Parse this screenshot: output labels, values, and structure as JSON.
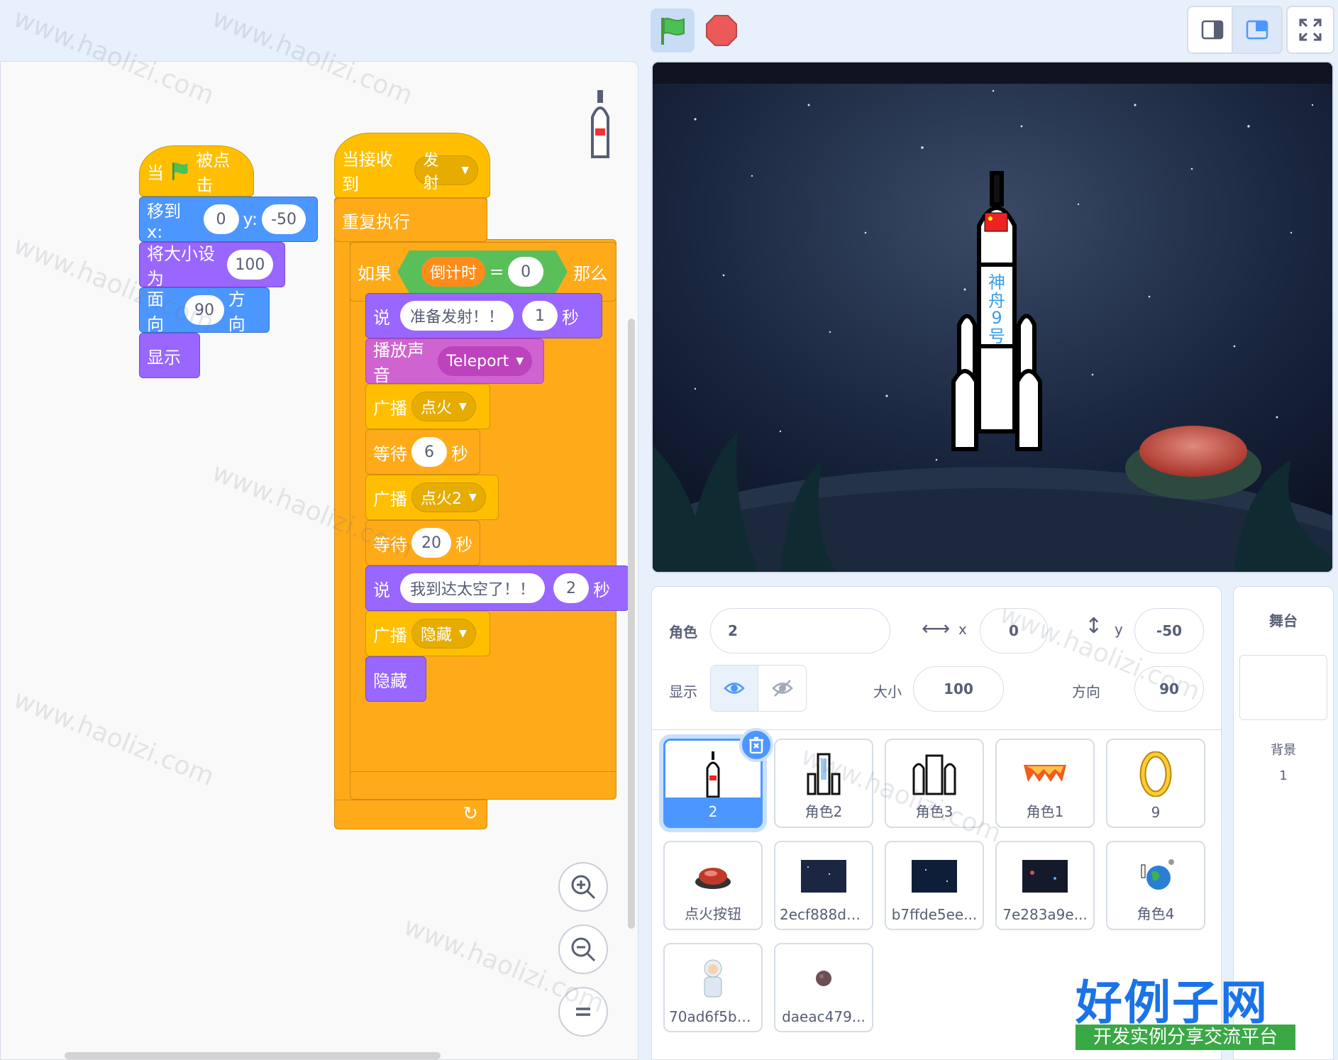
{
  "toolbar": {
    "green_flag": "green-flag-icon",
    "stop": "stop-icon"
  },
  "scripts": {
    "script1": {
      "hat_when": "当",
      "hat_clicked": "被点击",
      "goto_label": "移到 x:",
      "goto_x": "0",
      "goto_y_label": "y:",
      "goto_y": "-50",
      "setsize_label": "将大小设为",
      "setsize_value": "100",
      "point_label": "面向",
      "point_value": "90",
      "point_suffix": "方向",
      "show_label": "显示"
    },
    "script2": {
      "hat_label": "当接收到",
      "hat_message": "发射",
      "forever_label": "重复执行",
      "if_label": "如果",
      "if_var": "倒计时",
      "if_op": "=",
      "if_value": "0",
      "if_then": "那么",
      "say1_label": "说",
      "say1_text": "准备发射！！",
      "say1_secs": "1",
      "say1_unit": "秒",
      "sound_label": "播放声音",
      "sound_name": "Teleport",
      "bc1_label": "广播",
      "bc1_msg": "点火",
      "wait1_label": "等待",
      "wait1_value": "6",
      "wait1_unit": "秒",
      "bc2_label": "广播",
      "bc2_msg": "点火2",
      "wait2_label": "等待",
      "wait2_value": "20",
      "wait2_unit": "秒",
      "say2_label": "说",
      "say2_text": "我到达太空了！！",
      "say2_secs": "2",
      "say2_unit": "秒",
      "bc3_label": "广播",
      "bc3_msg": "隐藏",
      "hide_label": "隐藏"
    }
  },
  "stage": {
    "rocket_text": [
      "神",
      "舟",
      "9",
      "号"
    ]
  },
  "sprite_info": {
    "sprite_label": "角色",
    "sprite_name": "2",
    "x_label": "x",
    "x_value": "0",
    "y_label": "y",
    "y_value": "-50",
    "show_label": "显示",
    "size_label": "大小",
    "size_value": "100",
    "direction_label": "方向",
    "direction_value": "90"
  },
  "sprites": [
    {
      "name": "2",
      "selected": true
    },
    {
      "name": "角色2"
    },
    {
      "name": "角色3"
    },
    {
      "name": "角色1"
    },
    {
      "name": "9"
    },
    {
      "name": "点火按钮"
    },
    {
      "name": "2ecf888d0..."
    },
    {
      "name": "b7ffde5ee..."
    },
    {
      "name": "7e283a9e..."
    },
    {
      "name": "角色4"
    },
    {
      "name": "70ad6f5b4..."
    },
    {
      "name": "daeac479..."
    }
  ],
  "stage_panel": {
    "title": "舞台",
    "backdrop_label": "背景",
    "backdrop_count": "1"
  },
  "watermark": {
    "text": "www.haolizi.com",
    "logo_main": "好例子网",
    "logo_sub": "开发实例分享交流平台"
  },
  "colors": {
    "events": "#ffbf00",
    "motion": "#4c97ff",
    "looks": "#9966ff",
    "control": "#ffab19",
    "sound": "#cf63cf",
    "operators": "#59c059",
    "variables": "#ff8c1a"
  }
}
